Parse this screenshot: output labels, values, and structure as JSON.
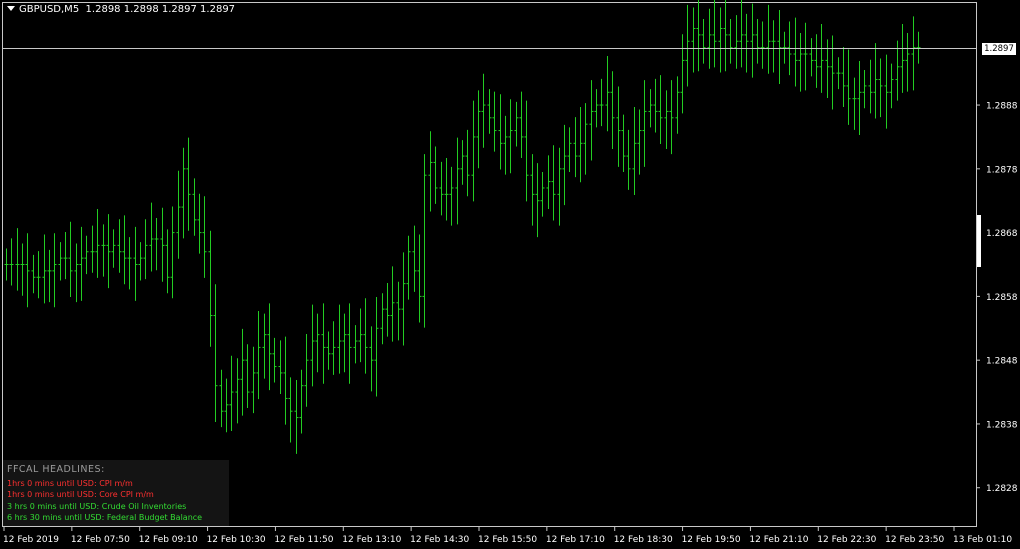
{
  "header": {
    "symbol": "GBPUSD,M5",
    "ohlc": "1.2898 1.2898 1.2897 1.2897"
  },
  "colors": {
    "background": "#000000",
    "bars": "#22cc22",
    "axis": "#c8c8c8",
    "text": "#ffffff",
    "alert_red": "#ff3030",
    "alert_green": "#33dd33"
  },
  "bid_label": "1.2897",
  "news_panel": {
    "title": "FFCAL HEADLINES:",
    "items": [
      {
        "text": "1hrs 0 mins until USD: CPI m/m",
        "color": "#ff3030"
      },
      {
        "text": "1hrs 0 mins until USD: Core CPI m/m",
        "color": "#ff3030"
      },
      {
        "text": "3 hrs 0 mins until USD: Crude Oil Inventories",
        "color": "#33dd33"
      },
      {
        "text": "6 hrs 30 mins until USD: Federal Budget Balance",
        "color": "#33dd33"
      }
    ]
  },
  "chart_data": {
    "type": "ohlc",
    "timeframe": "M5",
    "ylim": [
      1.2822,
      1.2904
    ],
    "y_ticks": [
      "1.2888",
      "1.2878",
      "1.2868",
      "1.2858",
      "1.2848",
      "1.2838",
      "1.2828"
    ],
    "x_ticks": [
      "12 Feb 2019",
      "12 Feb 07:50",
      "12 Feb 09:10",
      "12 Feb 10:30",
      "12 Feb 11:50",
      "12 Feb 13:10",
      "12 Feb 14:30",
      "12 Feb 15:50",
      "12 Feb 17:10",
      "12 Feb 18:30",
      "12 Feb 19:50",
      "12 Feb 21:10",
      "12 Feb 22:30",
      "12 Feb 23:50",
      "13 Feb 01:10"
    ],
    "bid": 1.2897,
    "closes": [
      1.2863,
      1.2863,
      1.2863,
      1.2863,
      1.2862,
      1.2861,
      1.2861,
      1.2862,
      1.2862,
      1.2863,
      1.2864,
      1.2864,
      1.2862,
      1.2863,
      1.2864,
      1.2865,
      1.2865,
      1.2866,
      1.2866,
      1.2865,
      1.2866,
      1.2865,
      1.2864,
      1.2864,
      1.2863,
      1.2864,
      1.2866,
      1.2867,
      1.2867,
      1.2866,
      1.2861,
      1.2868,
      1.2872,
      1.2878,
      1.2874,
      1.287,
      1.2868,
      1.2865,
      1.2855,
      1.2844,
      1.284,
      1.2841,
      1.2843,
      1.2845,
      1.2848,
      1.2843,
      1.2846,
      1.285,
      1.2852,
      1.2849,
      1.2847,
      1.2846,
      1.2842,
      1.284,
      1.2839,
      1.2844,
      1.2848,
      1.2851,
      1.2852,
      1.285,
      1.2849,
      1.285,
      1.2851,
      1.2852,
      1.285,
      1.2851,
      1.2852,
      1.285,
      1.2848,
      1.2853,
      1.2856,
      1.2855,
      1.2857,
      1.2856,
      1.286,
      1.2865,
      1.2862,
      1.2858,
      1.2877,
      1.2879,
      1.2875,
      1.2874,
      1.2874,
      1.2875,
      1.2878,
      1.288,
      1.2877,
      1.2883,
      1.2887,
      1.2888,
      1.2886,
      1.2884,
      1.2882,
      1.2883,
      1.2884,
      1.2886,
      1.2883,
      1.2877,
      1.2874,
      1.2873,
      1.2875,
      1.2876,
      1.2874,
      1.2878,
      1.288,
      1.2882,
      1.288,
      1.2882,
      1.2885,
      1.2887,
      1.2888,
      1.2888,
      1.289,
      1.2886,
      1.2884,
      1.288,
      1.2878,
      1.2882,
      1.2884,
      1.2887,
      1.2888,
      1.2887,
      1.2886,
      1.2887,
      1.2886,
      1.289,
      1.2895,
      1.2898,
      1.29,
      1.2899,
      1.2897,
      1.2899,
      1.2898,
      1.29,
      1.2899,
      1.2897,
      1.2898,
      1.2899,
      1.2898,
      1.2899,
      1.2897,
      1.2897,
      1.2898,
      1.2898,
      1.2897,
      1.2897,
      1.2896,
      1.2895,
      1.2896,
      1.2896,
      1.2895,
      1.2894,
      1.2895,
      1.2894,
      1.2893,
      1.2893,
      1.2891,
      1.2889,
      1.2889,
      1.289,
      1.2891,
      1.289,
      1.2892,
      1.2891,
      1.289,
      1.2892,
      1.2894,
      1.2895,
      1.2896,
      1.2897,
      1.2897
    ]
  }
}
